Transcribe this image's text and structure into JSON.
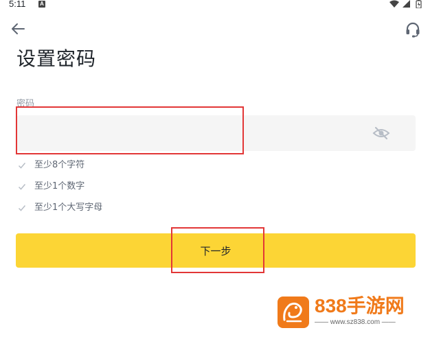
{
  "status_bar": {
    "time": "5:11",
    "notification_icon_letter": "A",
    "icons": [
      "wifi-icon",
      "signal-icon",
      "battery-icon"
    ]
  },
  "header": {
    "back_icon": "arrow-left-icon",
    "support_icon": "headset-icon"
  },
  "page": {
    "title": "设置密码"
  },
  "password_field": {
    "label": "密码",
    "value": "",
    "placeholder": "",
    "visibility_icon": "eye-off-icon"
  },
  "rules": [
    {
      "text": "至少8个字符"
    },
    {
      "text": "至少1个数字"
    },
    {
      "text": "至少1个大写字母"
    }
  ],
  "next_button": {
    "label": "下一步"
  },
  "watermark": {
    "title": "838手游网",
    "url": "—— www.sz838.com ——"
  },
  "colors": {
    "accent": "#fcd535",
    "field_bg": "#f5f5f5",
    "annotation": "#e23636",
    "check": "#b7bdc6"
  }
}
